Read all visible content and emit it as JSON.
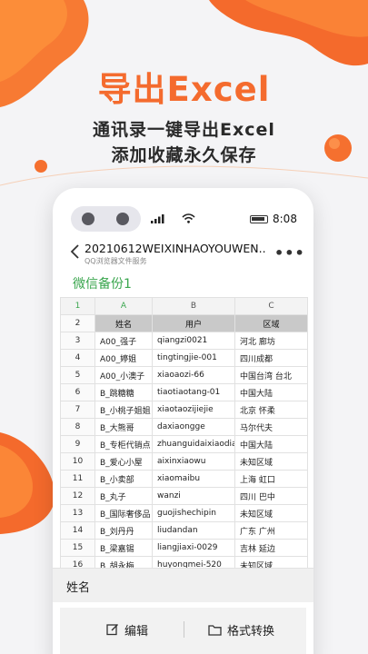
{
  "promo": {
    "headline": "导出Excel",
    "subline1": "通讯录一键导出Excel",
    "subline2": "添加收藏永久保存"
  },
  "status_bar": {
    "time": "8:08"
  },
  "document": {
    "title": "20210612WEIXINHAOYOUWEN...",
    "subtitle": "QQ浏览器文件服务",
    "more_label": "•••",
    "sheet_name": "微信备份1"
  },
  "sheet": {
    "columns": [
      "A",
      "B",
      "C"
    ],
    "rows": [
      {
        "n": "1",
        "a": "A",
        "b": "B",
        "c": "C"
      },
      {
        "n": "2",
        "a": "姓名",
        "b": "用户",
        "c": "区域"
      },
      {
        "n": "3",
        "a": "A00_强子",
        "b": "qiangzi0021",
        "c": "河北 廊坊"
      },
      {
        "n": "4",
        "a": "A00_婷姐",
        "b": "tingtingjie-001",
        "c": "四川成都"
      },
      {
        "n": "5",
        "a": "A00_小澳子",
        "b": "xiaoaozi-66",
        "c": "中国台湾 台北"
      },
      {
        "n": "6",
        "a": "B_跳糖糖",
        "b": "tiaotiaotang-01",
        "c": "中国大陆"
      },
      {
        "n": "7",
        "a": "B_小桃子姐姐",
        "b": "xiaotaozijiejie",
        "c": "北京 怀柔"
      },
      {
        "n": "8",
        "a": "B_大熊哥",
        "b": "daxiaongge",
        "c": "马尔代夫"
      },
      {
        "n": "9",
        "a": "B_专柜代销点",
        "b": "zhuanguidaixiaodian",
        "c": "中国大陆"
      },
      {
        "n": "10",
        "a": "B_爱心小屋",
        "b": "aixinxiaowu",
        "c": "未知区域"
      },
      {
        "n": "11",
        "a": "B_小卖部",
        "b": "xiaomaibu",
        "c": "上海 虹口"
      },
      {
        "n": "12",
        "a": "B_丸子",
        "b": "wanzi",
        "c": "四川 巴中"
      },
      {
        "n": "13",
        "a": "B_国际奢侈品",
        "b": "guojishechipin",
        "c": "未知区域"
      },
      {
        "n": "14",
        "a": "B_刘丹丹",
        "b": "liudandan",
        "c": "广东 广州"
      },
      {
        "n": "15",
        "a": "B_梁嘉锡",
        "b": "liangjiaxi-0029",
        "c": "吉林 延边"
      },
      {
        "n": "16",
        "a": "B_胡永梅",
        "b": "huyongmei-520",
        "c": "未知区域"
      }
    ]
  },
  "cell_content": "姓名",
  "actions": {
    "edit": "编辑",
    "format": "格式转换"
  },
  "colors": {
    "accent_orange": "#f46b2e",
    "sheet_green": "#3aa64e",
    "header_gray": "#c9c9c9"
  },
  "icons": [
    "back-chevron-icon",
    "signal-icon",
    "wifi-icon",
    "battery-icon",
    "edit-icon",
    "folder-icon"
  ]
}
